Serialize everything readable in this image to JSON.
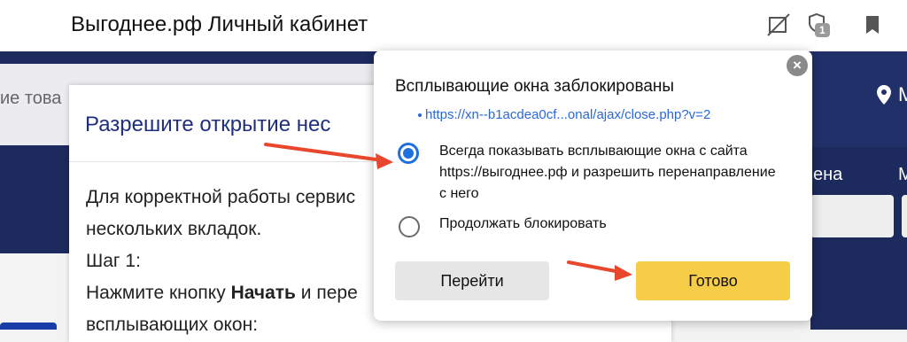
{
  "browser": {
    "tab_title": "Выгоднее.рф Личный кабинет",
    "badge_count": "1",
    "icons": [
      "popup-blocked-icon",
      "shield-icon",
      "bookmark-icon"
    ]
  },
  "site": {
    "search_placeholder": "ие това",
    "right_label_1": "ена",
    "right_label_2": "М"
  },
  "modal": {
    "title": "Разрешите открытие нес",
    "body_line1": "Для корректной работы сервис",
    "body_line2": "нескольких вкладок.",
    "body_line3": "Шаг 1:",
    "body_line4_pre": "Нажмите кнопку ",
    "body_line4_bold": "Начать",
    "body_line4_post": " и пере",
    "body_line5": "всплывающих окон:"
  },
  "popup": {
    "title": "Всплывающие окна заблокированы",
    "link": "https://xn--b1acdea0cf...onal/ajax/close.php?v=2",
    "option_always": "Всегда показывать всплывающие окна с сайта https://выгоднее.рф и разрешить перенаправление с него",
    "option_block": "Продолжать блокировать",
    "selected_option": "always",
    "go_button": "Перейти",
    "done_button": "Готово"
  },
  "colors": {
    "accent": "#1f6fe0",
    "done_button": "#f5cd47",
    "arrow": "#e8472e",
    "site_navy": "#1c2a5e"
  }
}
